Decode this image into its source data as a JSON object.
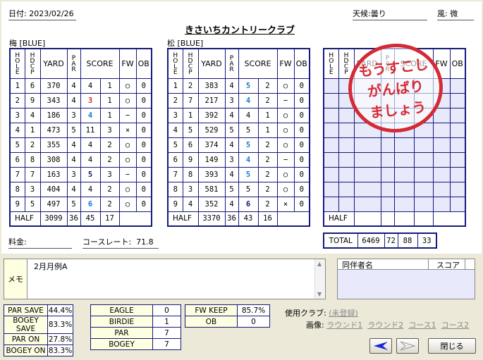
{
  "header": {
    "date_label": "日付:",
    "date_value": "2023/02/26",
    "weather_label": "天候:",
    "weather_value": "曇り",
    "wind_label": "風:",
    "wind_value": "微",
    "course_name": "きさいちカントリークラブ"
  },
  "columns": {
    "hole": "HOLE",
    "hdcp": "HDCP",
    "yard": "YARD",
    "par": "PAR",
    "score": "SCORE",
    "fw": "FW",
    "ob": "OB"
  },
  "front": {
    "label": "梅 [BLUE]",
    "rows": [
      [
        "1",
        "6",
        "370",
        "4",
        "4",
        "1",
        "○",
        "0"
      ],
      [
        "2",
        "9",
        "343",
        "4",
        "3",
        "1",
        "○",
        "0"
      ],
      [
        "3",
        "4",
        "186",
        "3",
        "4",
        "1",
        "−",
        "0"
      ],
      [
        "4",
        "1",
        "473",
        "5",
        "11",
        "3",
        "×",
        "0"
      ],
      [
        "5",
        "2",
        "355",
        "4",
        "4",
        "2",
        "○",
        "0"
      ],
      [
        "6",
        "8",
        "308",
        "4",
        "4",
        "2",
        "○",
        "0"
      ],
      [
        "7",
        "7",
        "163",
        "3",
        "5",
        "3",
        "−",
        "0"
      ],
      [
        "8",
        "3",
        "404",
        "4",
        "4",
        "2",
        "○",
        "0"
      ],
      [
        "9",
        "5",
        "497",
        "5",
        "6",
        "2",
        "○",
        "0"
      ]
    ],
    "score_colors": [
      "",
      "red",
      "blue",
      "",
      "",
      "",
      "navy",
      "",
      "blue"
    ],
    "half": {
      "label": "HALF",
      "yard": "3099",
      "par": "36",
      "score": "45",
      "putts": "17"
    }
  },
  "back": {
    "label": "松 [BLUE]",
    "rows": [
      [
        "1",
        "2",
        "383",
        "4",
        "5",
        "2",
        "○",
        "0"
      ],
      [
        "2",
        "7",
        "217",
        "3",
        "4",
        "2",
        "−",
        "0"
      ],
      [
        "3",
        "1",
        "392",
        "4",
        "4",
        "1",
        "○",
        "0"
      ],
      [
        "4",
        "5",
        "529",
        "5",
        "5",
        "1",
        "○",
        "0"
      ],
      [
        "5",
        "6",
        "374",
        "4",
        "5",
        "2",
        "○",
        "0"
      ],
      [
        "6",
        "9",
        "149",
        "3",
        "4",
        "2",
        "−",
        "0"
      ],
      [
        "7",
        "8",
        "393",
        "4",
        "5",
        "2",
        "○",
        "0"
      ],
      [
        "8",
        "3",
        "581",
        "5",
        "5",
        "2",
        "○",
        "0"
      ],
      [
        "9",
        "4",
        "352",
        "4",
        "6",
        "2",
        "×",
        "0"
      ]
    ],
    "score_colors": [
      "blue",
      "blue",
      "",
      "",
      "blue",
      "blue",
      "blue",
      "",
      "navy"
    ],
    "half": {
      "label": "HALF",
      "yard": "3370",
      "par": "36",
      "score": "43",
      "putts": "16"
    }
  },
  "third": {
    "half_label": "HALF"
  },
  "total": {
    "label": "TOTAL",
    "yard": "6469",
    "par": "72",
    "score": "88",
    "putts": "33"
  },
  "stamp": {
    "line1": "もうすこし",
    "line2": "がんばり",
    "line3": "ましょう"
  },
  "fee_label": "料金:",
  "course_rate_label": "コースレート:",
  "course_rate_value": "71.8",
  "memo": {
    "label": "メモ",
    "text": "2月月例A"
  },
  "companions": {
    "name_header": "同伴者名",
    "score_header": "スコア"
  },
  "stats_left": [
    {
      "k": "PAR SAVE",
      "v": "44.4%"
    },
    {
      "k": "BOGEY SAVE",
      "v": "83.3%"
    },
    {
      "k": "PAR ON",
      "v": "27.8%"
    },
    {
      "k": "BOGEY ON",
      "v": "83.3%"
    }
  ],
  "stats_mid": [
    {
      "k": "EAGLE",
      "v": "0"
    },
    {
      "k": "BIRDIE",
      "v": "1"
    },
    {
      "k": "PAR",
      "v": "7"
    },
    {
      "k": "BOGEY",
      "v": "7"
    }
  ],
  "stats_right": [
    {
      "k": "FW KEEP",
      "v": "85.7%"
    },
    {
      "k": "OB",
      "v": "0"
    }
  ],
  "club_label": "使用クラブ:",
  "club_link": "(未登録)",
  "image_label": "画像:",
  "image_links": [
    "ラウンド1",
    "ラウンド2",
    "コース1",
    "コース2"
  ],
  "buttons": {
    "close": "閉じる"
  }
}
